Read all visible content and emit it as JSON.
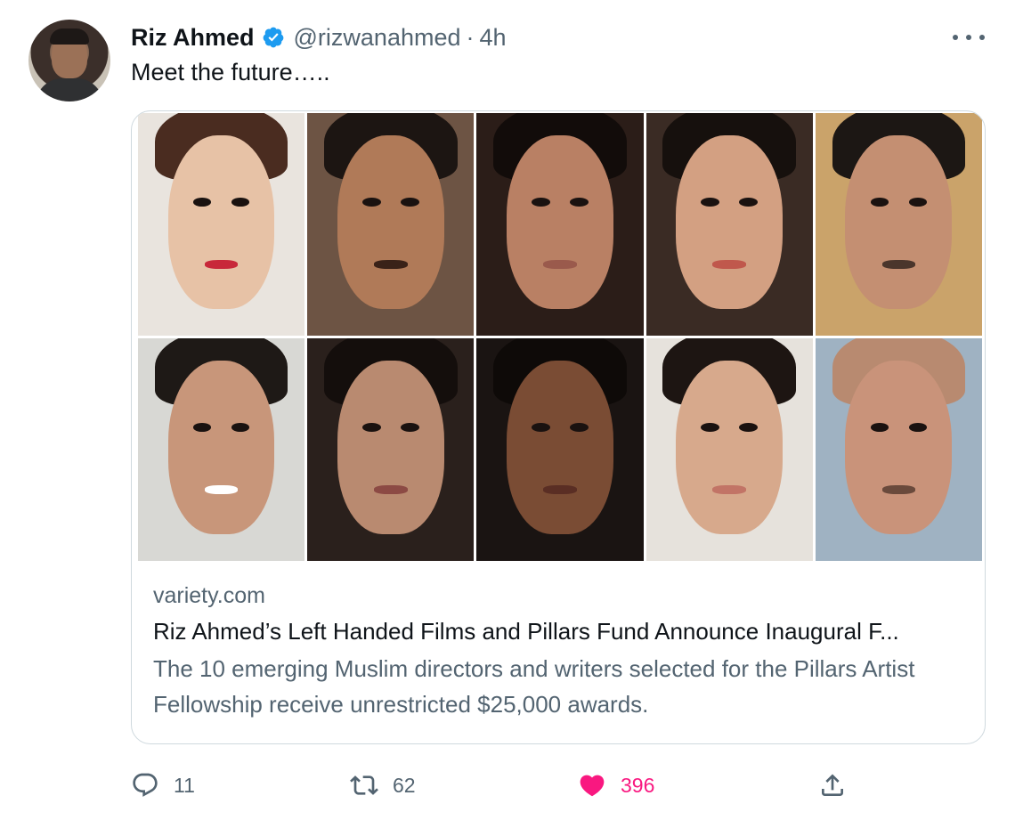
{
  "tweet": {
    "author_name": "Riz Ahmed",
    "handle": "@rizwanahmed",
    "separator": "·",
    "time": "4h",
    "text": "Meet the future….."
  },
  "card": {
    "domain": "variety.com",
    "title": "Riz Ahmed’s Left Handed Films and Pillars Fund Announce Inaugural F...",
    "description": "The 10 emerging Muslim directors and writers selected for the Pillars Artist Fellowship receive unrestricted $25,000 awards.",
    "photo_count": 10
  },
  "actions": {
    "reply_count": "11",
    "retweet_count": "62",
    "like_count": "396",
    "like_color": "#f91880"
  },
  "icons": {
    "verified": "verified-badge-icon",
    "more": "more-horizontal-icon",
    "reply": "speech-bubble-icon",
    "retweet": "retweet-arrows-icon",
    "like": "heart-filled-icon",
    "share": "share-upload-icon"
  },
  "colors": {
    "text_primary": "#0f1419",
    "text_secondary": "#536471",
    "verified_blue": "#1d9bf0",
    "border": "#cfd9de"
  }
}
